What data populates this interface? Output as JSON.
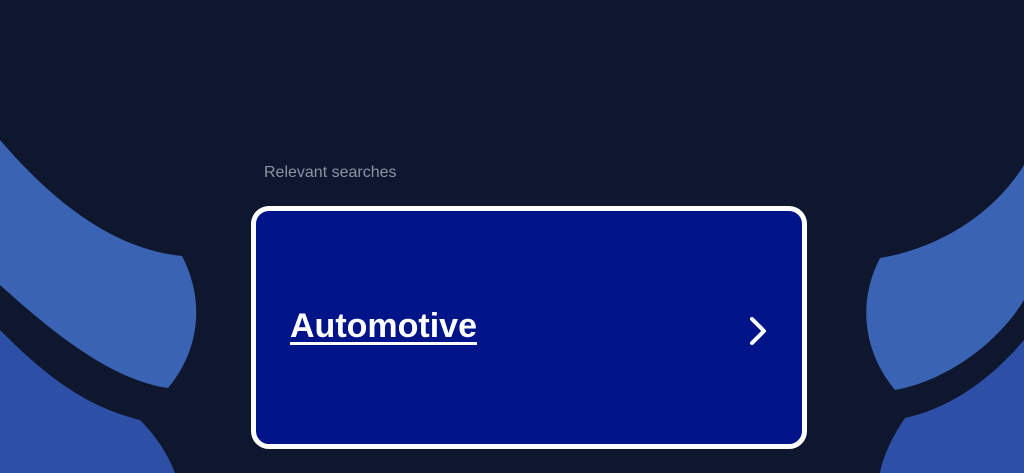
{
  "page": {
    "background_color": "#0f172e",
    "accent_colors": [
      "#3a63b4",
      "#2e4fa6",
      "#001489"
    ]
  },
  "relevant_searches": {
    "label": "Relevant searches",
    "items": [
      {
        "label": "Automotive",
        "icon": "chevron-right-icon"
      }
    ]
  }
}
